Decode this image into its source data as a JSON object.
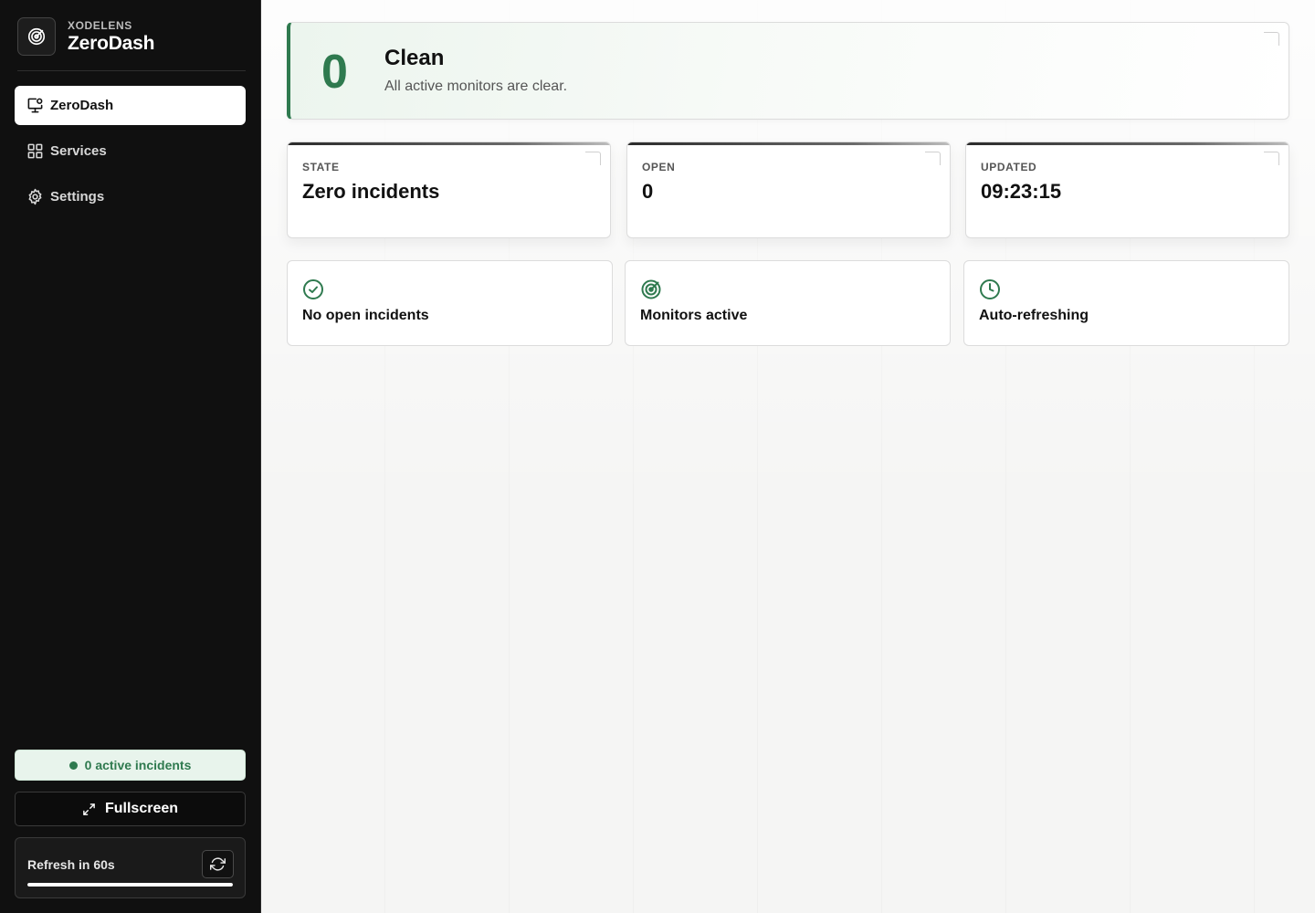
{
  "brand": {
    "kicker": "XODELENS",
    "name": "ZeroDash",
    "logo_icon": "radar-icon"
  },
  "nav": {
    "items": [
      {
        "label": "ZeroDash",
        "icon": "monitor-icon",
        "active": true
      },
      {
        "label": "Services",
        "icon": "grid-icon",
        "active": false
      },
      {
        "label": "Settings",
        "icon": "gear-icon",
        "active": false
      }
    ]
  },
  "sidebar_footer": {
    "incident_pill": "0 active incidents",
    "fullscreen_label": "Fullscreen",
    "refresh_label": "Refresh in 60s",
    "refresh_progress": 1.0
  },
  "hero": {
    "count": "0",
    "title": "Clean",
    "subtitle": "All active monitors are clear."
  },
  "stats": [
    {
      "label": "STATE",
      "value": "Zero incidents"
    },
    {
      "label": "OPEN",
      "value": "0"
    },
    {
      "label": "UPDATED",
      "value": "09:23:15"
    }
  ],
  "features": [
    {
      "label": "No open incidents",
      "icon": "check-circle-icon"
    },
    {
      "label": "Monitors active",
      "icon": "radar-icon"
    },
    {
      "label": "Auto-refreshing",
      "icon": "clock-icon"
    }
  ],
  "colors": {
    "accent": "#2f7a4f",
    "sidebar_bg": "#101010",
    "pill_bg": "#e8f4ec"
  }
}
